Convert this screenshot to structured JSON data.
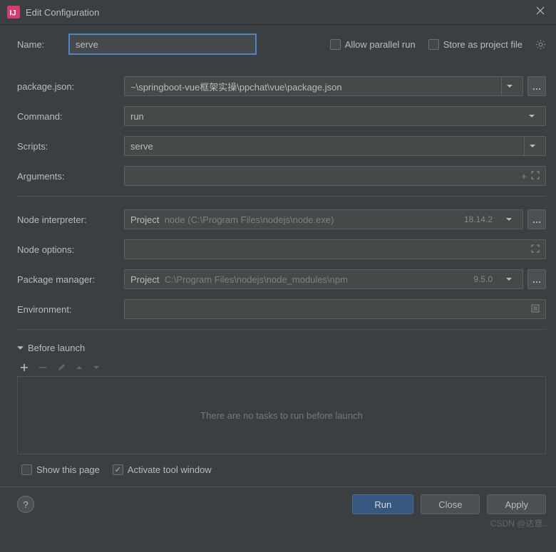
{
  "window": {
    "title": "Edit Configuration"
  },
  "name": {
    "label": "Name:",
    "value": "serve"
  },
  "options": {
    "allow_parallel": {
      "label": "Allow parallel run",
      "checked": false
    },
    "store_as_file": {
      "label": "Store as project file",
      "checked": false
    }
  },
  "fields": {
    "package_json": {
      "label": "package.json:",
      "value": "~\\springboot-vue框架实操\\ppchat\\vue\\package.json"
    },
    "command": {
      "label": "Command:",
      "value": "run"
    },
    "scripts": {
      "label": "Scripts:",
      "value": "serve"
    },
    "arguments": {
      "label": "Arguments:"
    },
    "node_interpreter": {
      "label": "Node interpreter:",
      "prefix": "Project",
      "value": "node (C:\\Program Files\\nodejs\\node.exe)",
      "version": "18.14.2"
    },
    "node_options": {
      "label": "Node options:"
    },
    "package_manager": {
      "label": "Package manager:",
      "prefix": "Project",
      "value": "C:\\Program Files\\nodejs\\node_modules\\npm",
      "version": "9.5.0"
    },
    "environment": {
      "label": "Environment:"
    }
  },
  "before_launch": {
    "title": "Before launch",
    "empty_text": "There are no tasks to run before launch",
    "show_this_page": {
      "label": "Show this page",
      "checked": false
    },
    "activate_tool_window": {
      "label": "Activate tool window",
      "checked": true
    }
  },
  "buttons": {
    "run": "Run",
    "close": "Close",
    "apply": "Apply"
  },
  "watermark": "CSDN @达意.."
}
